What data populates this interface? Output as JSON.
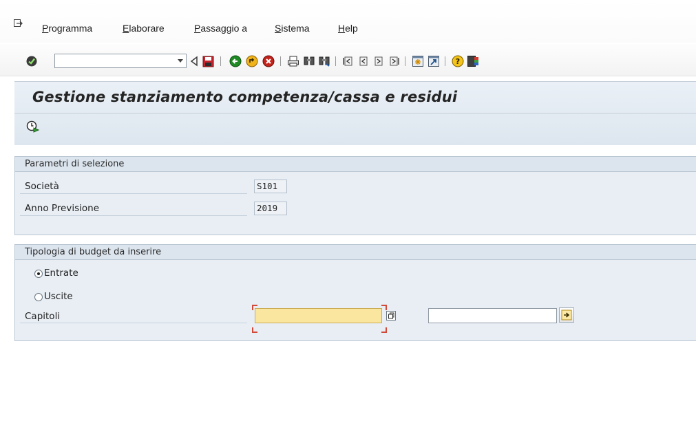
{
  "menu": {
    "items": [
      "Programma",
      "Elaborare",
      "Passaggio a",
      "Sistema",
      "Help"
    ]
  },
  "toolbar": {
    "command_field_value": "",
    "icons": [
      "enter-icon",
      "back-icon",
      "save-icon",
      "back-green-icon",
      "exit-icon",
      "cancel-icon",
      "print-icon",
      "find-icon",
      "find-next-icon",
      "first-page-icon",
      "previous-page-icon",
      "next-page-icon",
      "last-page-icon",
      "new-session-icon",
      "shortcut-icon",
      "help-icon",
      "customize-layout-icon"
    ]
  },
  "screen": {
    "title": "Gestione stanziamento competenza/cassa e residui"
  },
  "selection_params": {
    "header": "Parametri di selezione",
    "company_label": "Società",
    "company_value": "S101",
    "year_label": "Anno Previsione",
    "year_value": "2019"
  },
  "budget_type": {
    "header": "Tipologia di budget da inserire",
    "option_income": "Entrate",
    "option_expense": "Uscite",
    "selected": "Entrate",
    "chapters_label": "Capitoli",
    "chapters_from": "",
    "chapters_to": ""
  },
  "colors": {
    "title_area": "#dde6ef",
    "group_bg": "#e8eef4",
    "required_field": "#fbe6a0"
  }
}
